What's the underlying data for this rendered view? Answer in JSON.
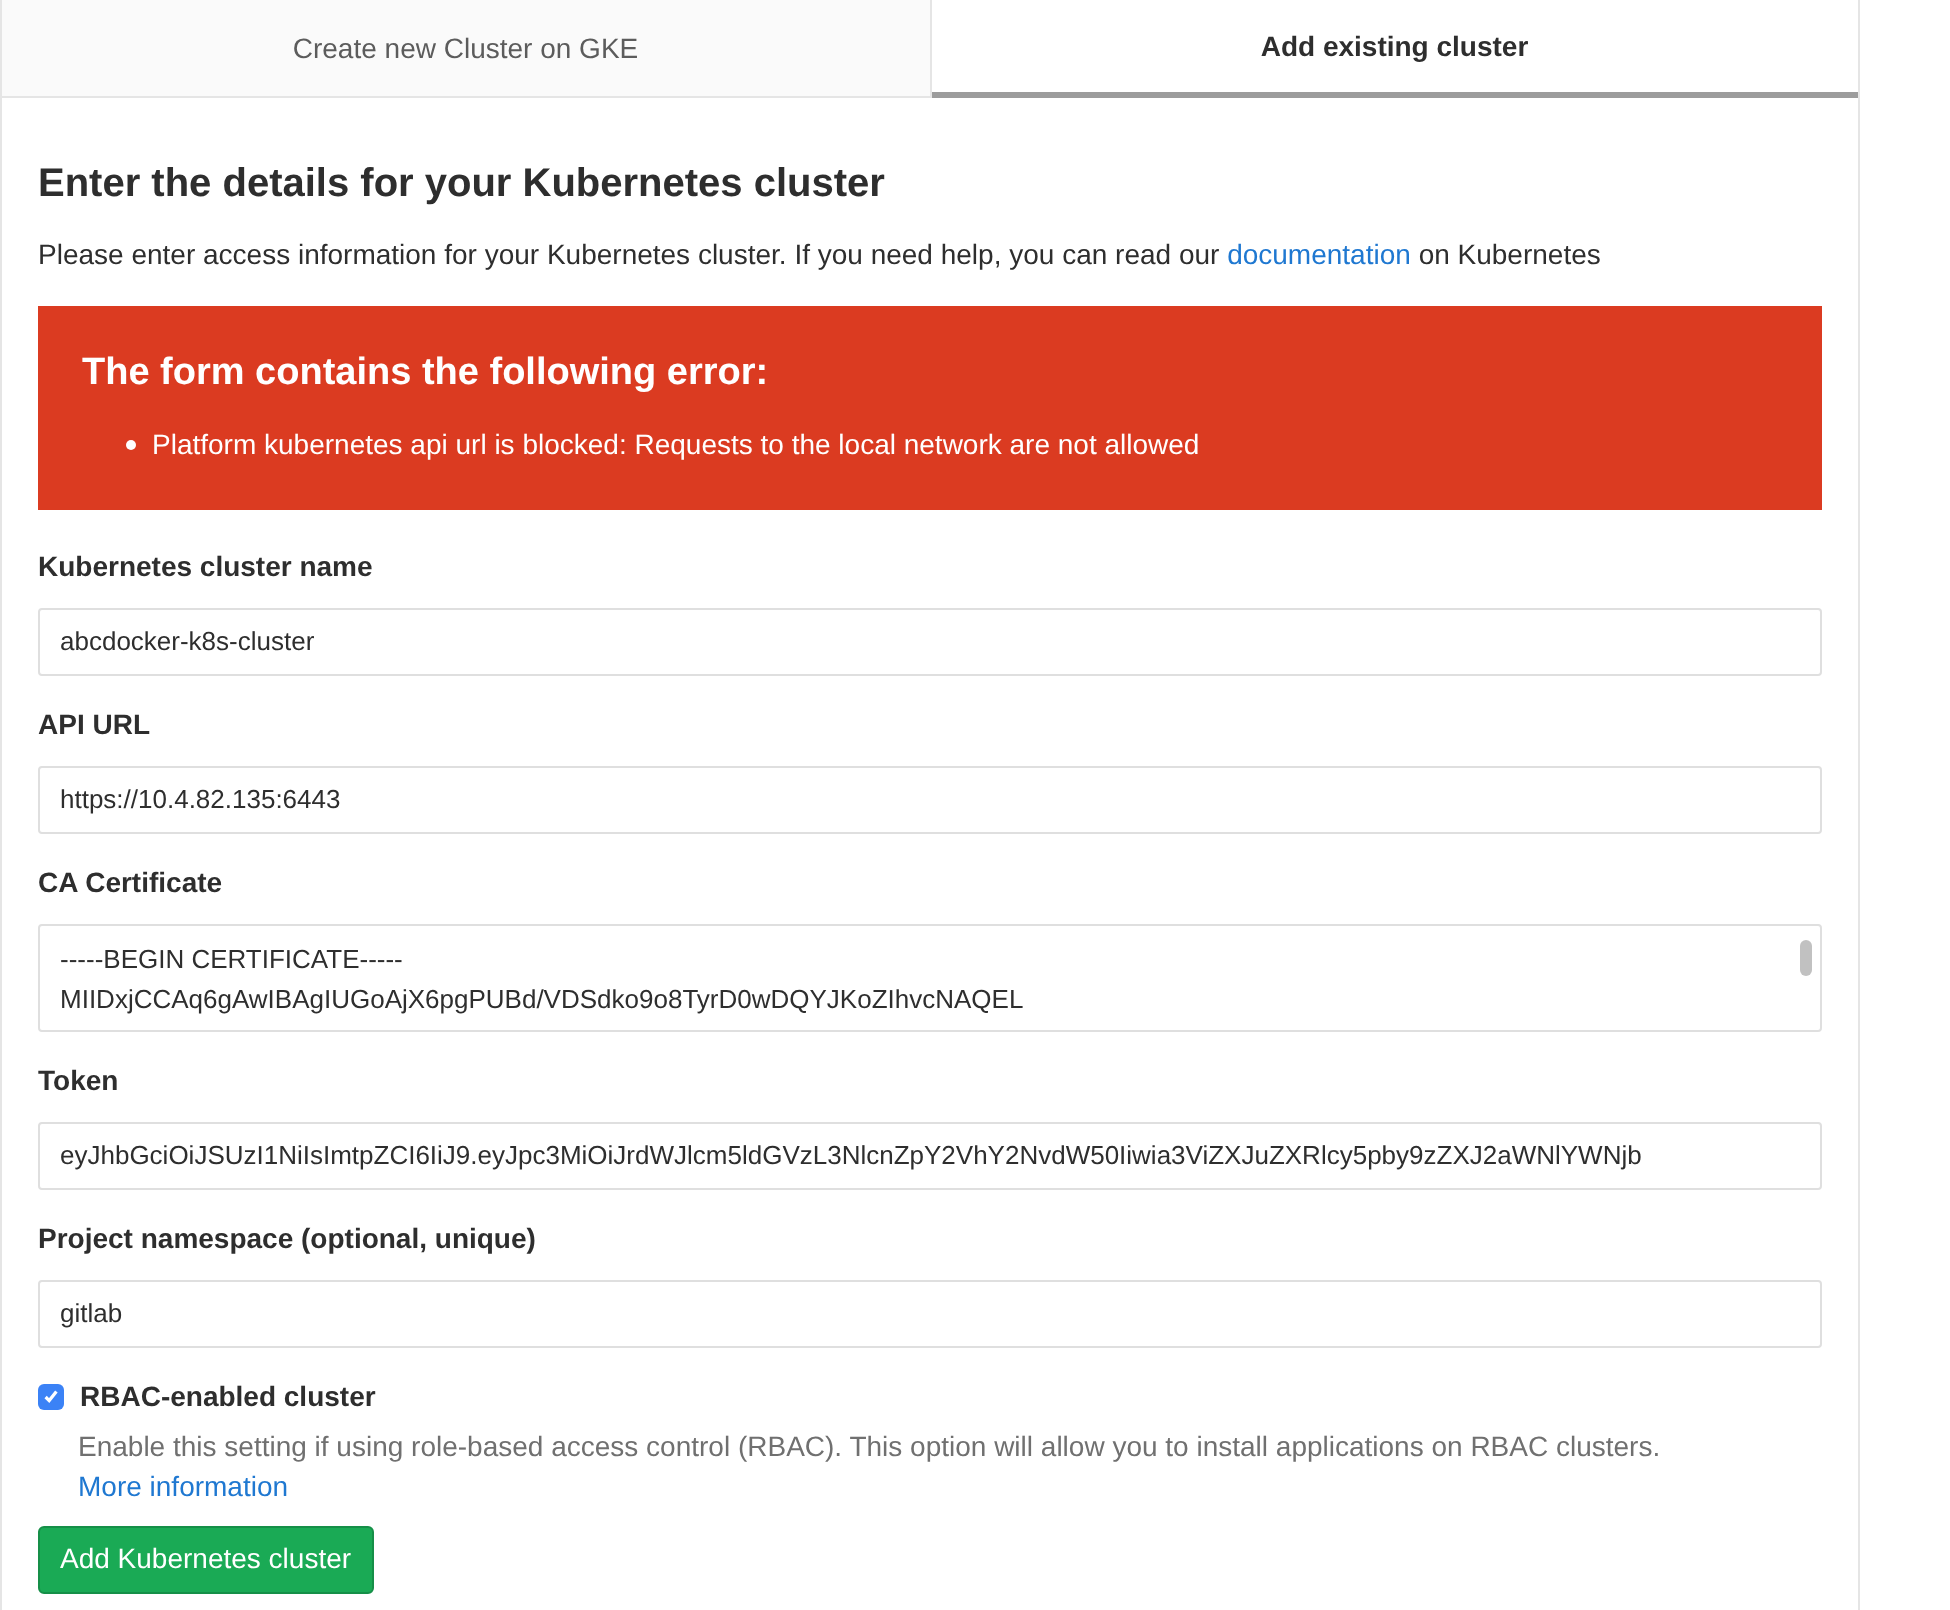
{
  "tabs": [
    {
      "label": "Create new Cluster on GKE",
      "selected": false
    },
    {
      "label": "Add existing cluster",
      "selected": true
    }
  ],
  "heading": "Enter the details for your Kubernetes cluster",
  "intro": {
    "before": "Please enter access information for your Kubernetes cluster. If you need help, you can read our",
    "link": "documentation",
    "after": "on Kubernetes"
  },
  "error": {
    "title": "The form contains the following error:",
    "items": [
      "Platform kubernetes api url is blocked: Requests to the local network are not allowed"
    ]
  },
  "fields": [
    {
      "kind": "input",
      "label": "Kubernetes cluster name",
      "value": "abcdocker-k8s-cluster"
    },
    {
      "kind": "input",
      "label": "API URL",
      "value": "https://10.4.82.135:6443"
    },
    {
      "kind": "textarea",
      "label": "CA Certificate",
      "lines": [
        "-----BEGIN CERTIFICATE-----",
        "MIIDxjCCAq6gAwIBAgIUGoAjX6pgPUBd/VDSdko9o8TyrD0wDQYJKoZIhvcNAQEL"
      ]
    },
    {
      "kind": "input",
      "label": "Token",
      "value": "eyJhbGciOiJSUzI1NiIsImtpZCI6IiJ9.eyJpc3MiOiJrdWJlcm5ldGVzL3NlcnZpY2VhY2NvdW50Iiwia3ViZXJuZXRlcy5pby9zZXJ2aWNlYWNjb"
    },
    {
      "kind": "input",
      "label": "Project namespace (optional, unique)",
      "value": "gitlab"
    }
  ],
  "rbac": {
    "label": "RBAC-enabled cluster",
    "checked": true,
    "help": "Enable this setting if using role-based access control (RBAC). This option will allow you to install applications on RBAC clusters.",
    "link": "More information"
  },
  "submit": "Add Kubernetes cluster"
}
